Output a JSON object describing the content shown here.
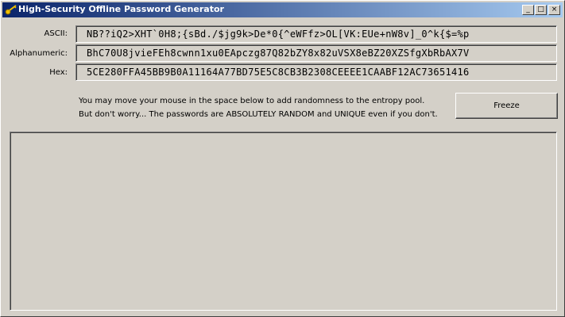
{
  "window": {
    "title": "High-Security Offline Password Generator",
    "icon": "key-icon",
    "controls": {
      "minimize": "_",
      "maximize": "□",
      "close": "×"
    }
  },
  "fields": [
    {
      "label": "ASCII:",
      "value": "NB??iQ2>XHT`0H8;{sBd./$jg9k>De*0{^eWFfz>OL[VK:EUe+nW8v]_0^k{$=%p"
    },
    {
      "label": "Alphanumeric:",
      "value": "BhC70U8jvieFEh8cwnn1xu0EApczg87Q82bZY8x82uVSX8eBZ20XZSfgXbRbAX7V"
    },
    {
      "label": "Hex:",
      "value": "5CE280FFA45BB9B0A11164A77BD75E5C8CB3B2308CEEEE1CAABF12AC73651416"
    }
  ],
  "info": {
    "line1": "You may move your mouse in the space below to add randomness to the entropy pool.",
    "line2": "But don't worry... The passwords are ABSOLUTELY RANDOM and UNIQUE even if you don't."
  },
  "freeze_label": "Freeze",
  "colors": {
    "titlebar_start": "#0a246a",
    "titlebar_end": "#a6caf0",
    "face": "#d4d0c8"
  }
}
